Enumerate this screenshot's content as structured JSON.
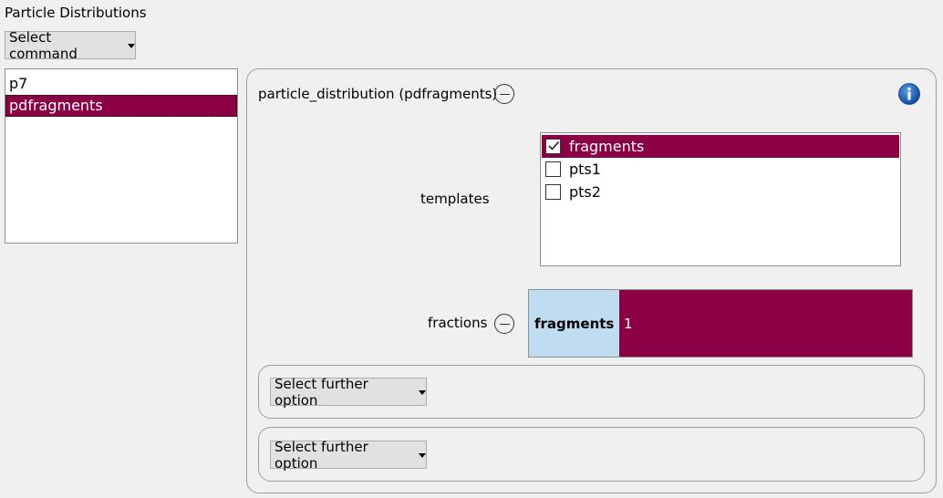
{
  "page": {
    "title": "Particle Distributions"
  },
  "command": {
    "label": "Select command"
  },
  "distributions": {
    "items": [
      {
        "label": "p7",
        "selected": false
      },
      {
        "label": "pdfragments",
        "selected": true
      }
    ]
  },
  "detail": {
    "header": "particle_distribution (pdfragments)",
    "info_icon": "info-icon",
    "templates": {
      "label": "templates",
      "options": [
        {
          "label": "fragments",
          "checked": true
        },
        {
          "label": "pts1",
          "checked": false
        },
        {
          "label": "pts2",
          "checked": false
        }
      ]
    },
    "fractions": {
      "label": "fractions",
      "key": "fragments",
      "value": "1"
    },
    "further_options": [
      {
        "label": "Select further option"
      },
      {
        "label": "Select further option"
      }
    ]
  },
  "colors": {
    "selection": "#8b0045",
    "fraction_key_bg": "#bfdcf0",
    "info_blue": "#1f5fb4"
  }
}
